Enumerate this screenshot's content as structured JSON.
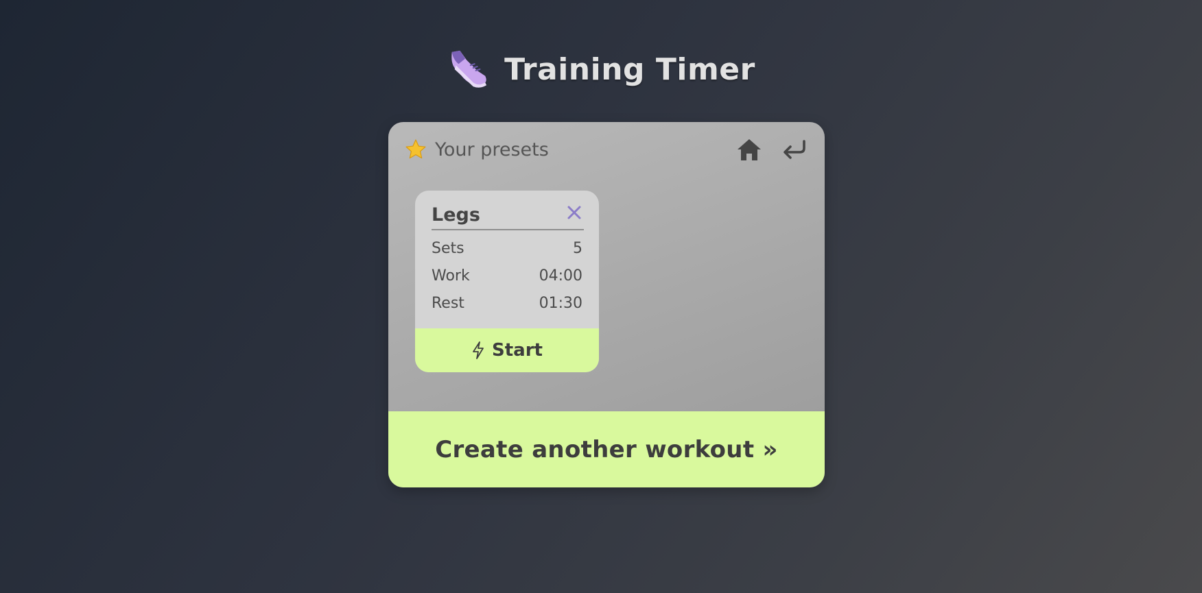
{
  "app": {
    "title": "Training Timer",
    "logo_icon": "running-shoe-icon"
  },
  "panel": {
    "title": "Your presets",
    "title_icon": "star-icon",
    "actions": [
      {
        "name": "home-icon"
      },
      {
        "name": "back-arrow-icon"
      }
    ]
  },
  "presets": [
    {
      "name": "Legs",
      "rows": [
        {
          "label": "Sets",
          "value": "5"
        },
        {
          "label": "Work",
          "value": "04:00"
        },
        {
          "label": "Rest",
          "value": "01:30"
        }
      ],
      "start_label": "Start",
      "start_icon": "lightning-icon",
      "delete_icon": "close-icon"
    }
  ],
  "create_label": "Create another workout »",
  "colors": {
    "accent": "#d9f99d",
    "delete": "#8b7cc8",
    "text_dark": "#3d3d3d",
    "title": "#e2e2e2"
  }
}
